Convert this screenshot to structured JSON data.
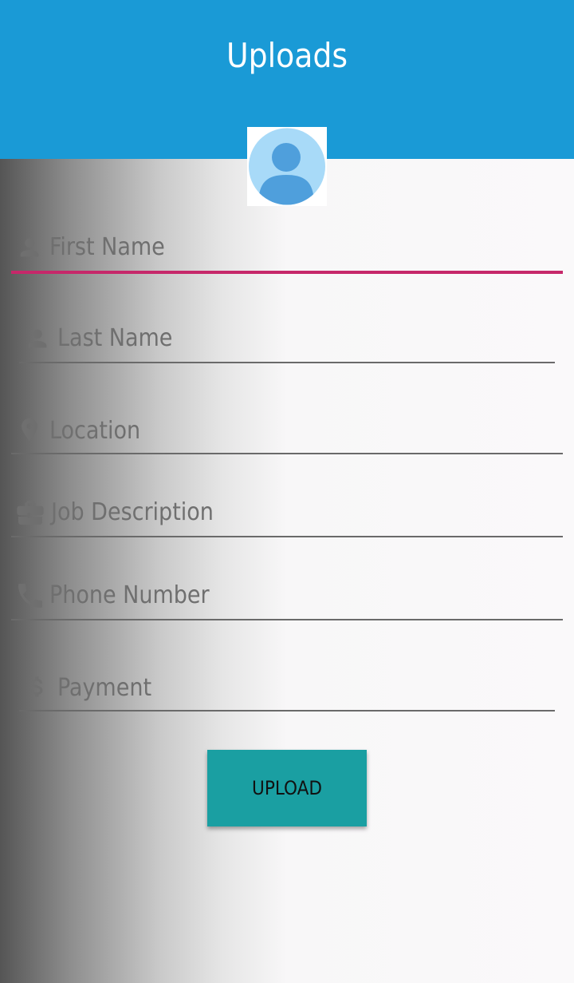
{
  "header": {
    "title": "Uploads"
  },
  "avatar": {
    "icon": "person-avatar-icon"
  },
  "form": {
    "first_name": {
      "placeholder": "First Name",
      "icon": "person-icon"
    },
    "last_name": {
      "placeholder": "Last Name",
      "icon": "person-icon"
    },
    "location": {
      "placeholder": "Location",
      "icon": "location-pin-icon"
    },
    "job_description": {
      "placeholder": "Job Description",
      "icon": "briefcase-icon"
    },
    "phone_number": {
      "placeholder": "Phone Number",
      "icon": "phone-icon"
    },
    "payment": {
      "placeholder": "Payment",
      "icon": "dollar-icon"
    }
  },
  "upload_button": {
    "label": "UPLOAD"
  },
  "colors": {
    "header_bg": "#1a9ad6",
    "active_underline": "#c6286a",
    "button_bg": "#1a9fa2",
    "avatar_bg": "#a8daf8",
    "avatar_fg": "#4f9fdc"
  }
}
